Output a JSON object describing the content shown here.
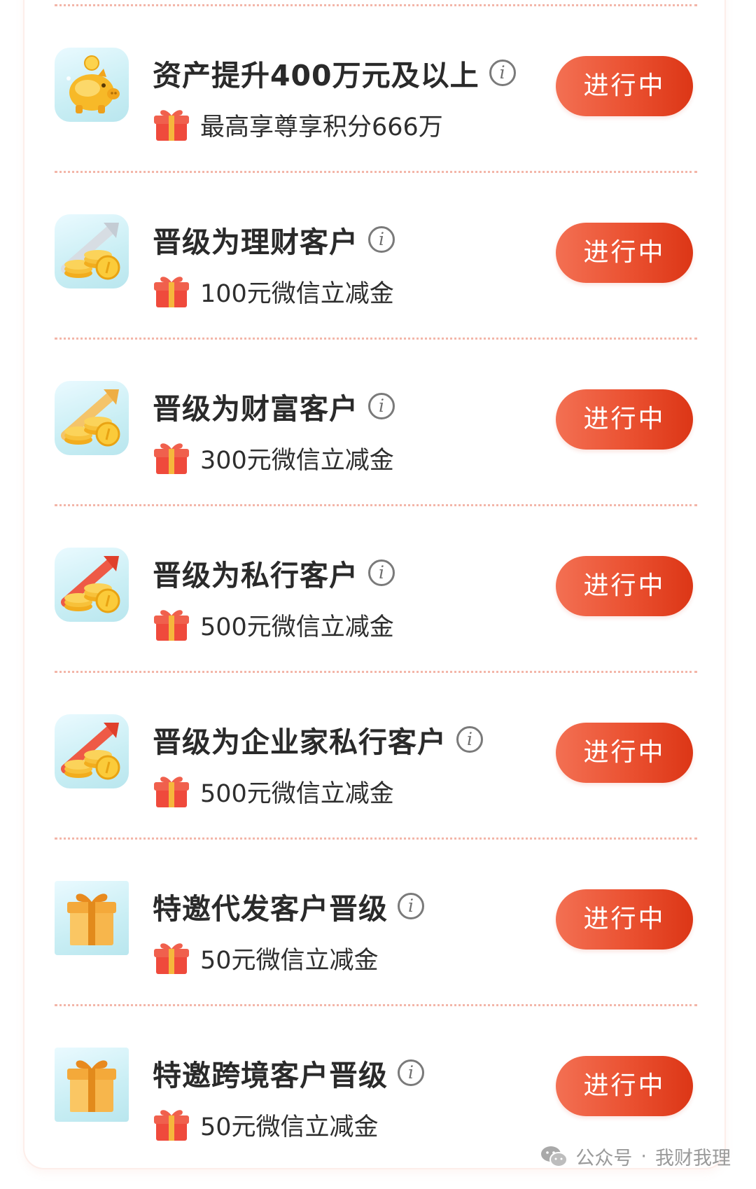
{
  "tasks": [
    {
      "title": "资产提升400万元及以上",
      "reward": "最高享尊享积分666万",
      "status": "进行中",
      "icon": "gold-piggy-bank-icon"
    },
    {
      "title": "晋级为理财客户",
      "reward": "100元微信立减金",
      "status": "进行中",
      "icon": "silver-arrow-coins-icon"
    },
    {
      "title": "晋级为财富客户",
      "reward": "300元微信立减金",
      "status": "进行中",
      "icon": "gold-arrow-coins-icon"
    },
    {
      "title": "晋级为私行客户",
      "reward": "500元微信立减金",
      "status": "进行中",
      "icon": "red-arrow-coins-icon"
    },
    {
      "title": "晋级为企业家私行客户",
      "reward": "500元微信立减金",
      "status": "进行中",
      "icon": "red-arrow-coins-icon"
    },
    {
      "title": "特邀代发客户晋级",
      "reward": "50元微信立减金",
      "status": "进行中",
      "icon": "gift-box-icon"
    },
    {
      "title": "特邀跨境客户晋级",
      "reward": "50元微信立减金",
      "status": "进行中",
      "icon": "gift-box-icon"
    }
  ],
  "info_glyph": "i",
  "watermark": {
    "source": "公众号",
    "separator": "·",
    "account": "我财我理",
    "icon": "wechat-icon"
  },
  "colors": {
    "button_start": "#f37053",
    "button_end": "#dc3616",
    "separator": "#f3b6a9",
    "gift_red": "#ef4a3c",
    "gift_ribbon": "#f6b73c"
  }
}
